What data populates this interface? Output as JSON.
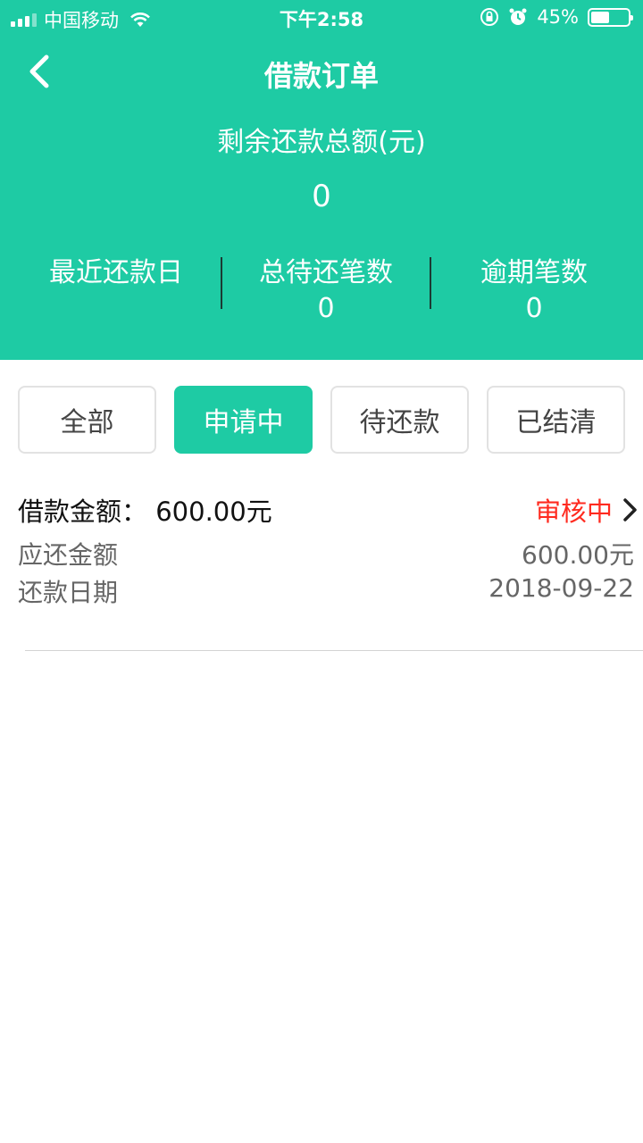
{
  "status_bar": {
    "carrier": "中国移动",
    "time": "下午2:58",
    "battery": "45%",
    "battery_level": 0.45
  },
  "header": {
    "title": "借款订单",
    "sum_label": "剩余还款总额(元)",
    "sum_value": "0",
    "stats": [
      {
        "label": "最近还款日",
        "value": ""
      },
      {
        "label": "总待还笔数",
        "value": "0"
      },
      {
        "label": "逾期笔数",
        "value": "0"
      }
    ]
  },
  "tabs": [
    {
      "label": "全部",
      "active": false
    },
    {
      "label": "申请中",
      "active": true
    },
    {
      "label": "待还款",
      "active": false
    },
    {
      "label": "已结清",
      "active": false
    }
  ],
  "order": {
    "loan_label": "借款金额：",
    "loan_amount": "600.00元",
    "status": "审核中",
    "due_amount_label": "应还金额",
    "due_amount": "600.00元",
    "due_date_label": "还款日期",
    "due_date": "2018-09-22"
  },
  "colors": {
    "accent": "#1ecba4",
    "status_red": "#ff2a1f"
  }
}
